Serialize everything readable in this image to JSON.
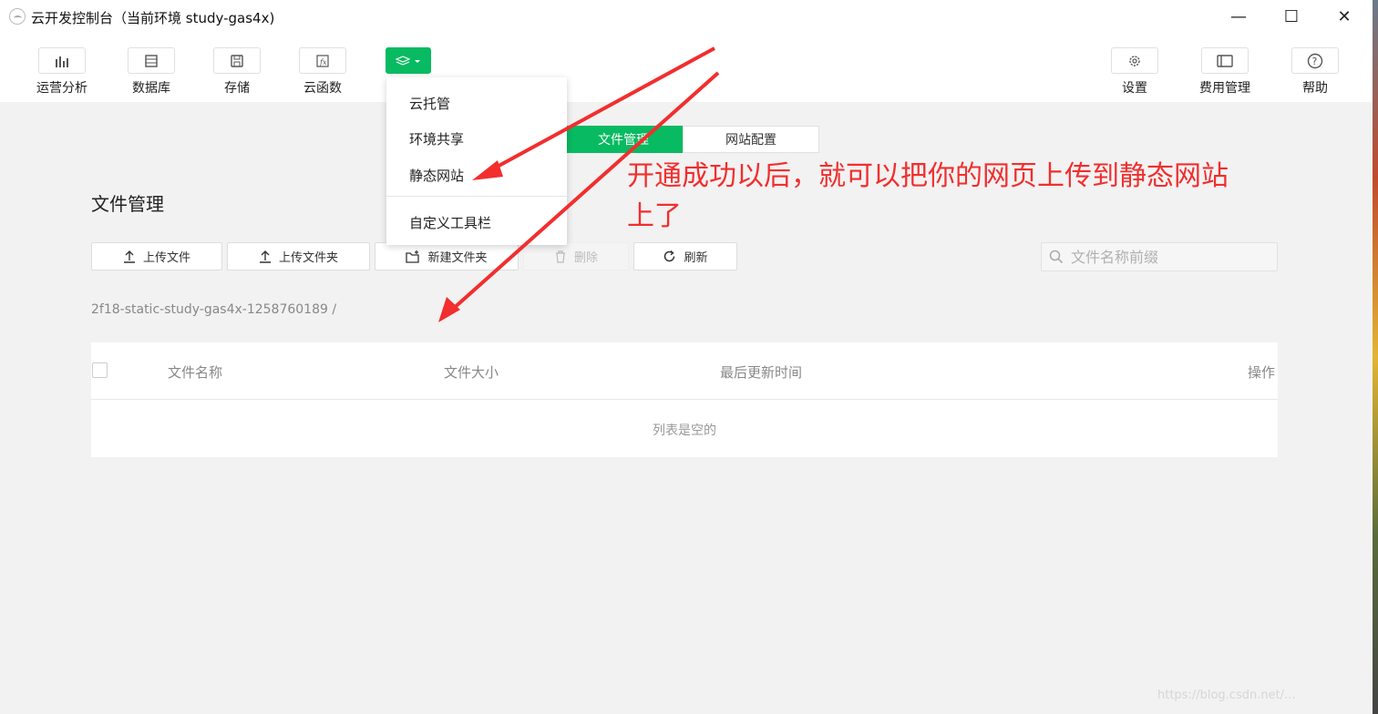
{
  "window": {
    "title": "云开发控制台（当前环境 study-gas4x)",
    "controls": {
      "minimize": "—",
      "maximize": "☐",
      "close": "✕"
    }
  },
  "toolbar": {
    "left": [
      {
        "label": "运营分析",
        "icon": "bar-chart-icon"
      },
      {
        "label": "数据库",
        "icon": "database-icon"
      },
      {
        "label": "存储",
        "icon": "storage-icon"
      },
      {
        "label": "云函数",
        "icon": "function-icon"
      }
    ],
    "more_icon": "layers-icon",
    "right": [
      {
        "label": "设置",
        "icon": "gear-icon"
      },
      {
        "label": "费用管理",
        "icon": "billing-icon"
      },
      {
        "label": "帮助",
        "icon": "help-icon"
      }
    ],
    "accent": "#08ba61"
  },
  "dropdown": {
    "items": [
      "云托管",
      "环境共享",
      "静态网站",
      "自定义工具栏"
    ]
  },
  "tabs": [
    {
      "label": "文件管理",
      "active": true
    },
    {
      "label": "网站配置",
      "active": false
    }
  ],
  "section_title": "文件管理",
  "actions": {
    "upload_file": "上传文件",
    "upload_folder": "上传文件夹",
    "new_folder": "新建文件夹",
    "delete": "删除",
    "refresh": "刷新"
  },
  "search": {
    "placeholder": "文件名称前缀"
  },
  "path": "2f18-static-study-gas4x-1258760189  /",
  "table": {
    "columns": [
      "文件名称",
      "文件大小",
      "最后更新时间",
      "操作"
    ],
    "empty_text": "列表是空的"
  },
  "annotation": {
    "text": "开通成功以后，就可以把你的网页上传到静态网站上了",
    "color": "#f22e2e"
  },
  "watermark": "https://blog.csdn.net/..."
}
